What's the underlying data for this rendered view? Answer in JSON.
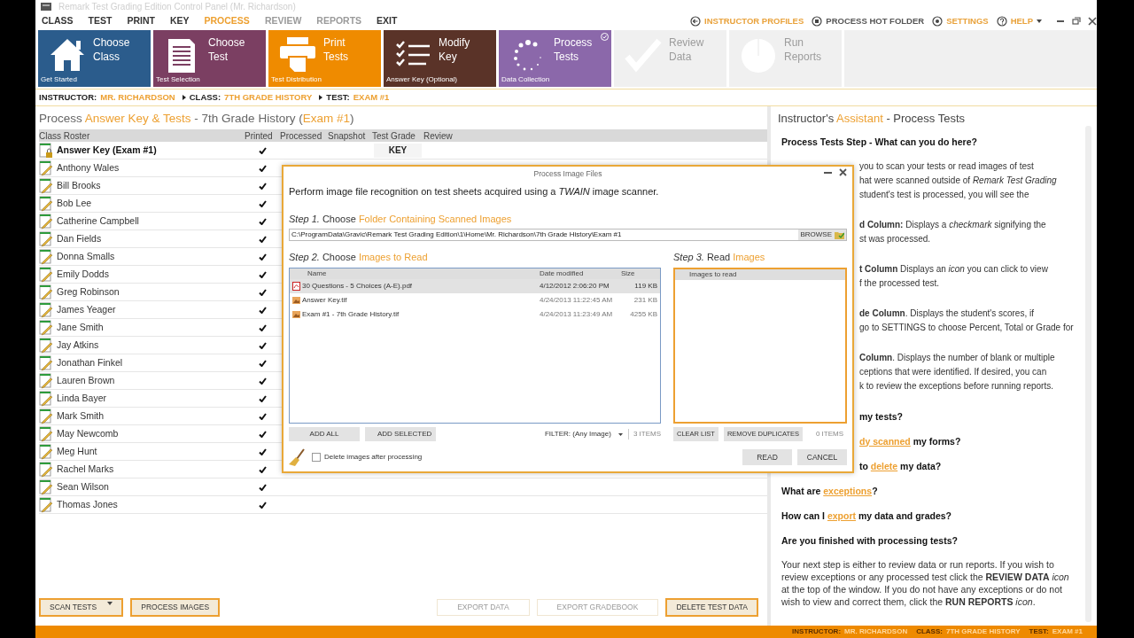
{
  "window": {
    "title": "Remark Test Grading Edition Control Panel (Mr. Richardson)"
  },
  "menu": [
    {
      "label": "CLASS",
      "selected": false,
      "disabled": false
    },
    {
      "label": "TEST",
      "selected": false,
      "disabled": false
    },
    {
      "label": "PRINT",
      "selected": false,
      "disabled": false
    },
    {
      "label": "KEY",
      "selected": false,
      "disabled": false
    },
    {
      "label": "PROCESS",
      "selected": true,
      "disabled": false
    },
    {
      "label": "REVIEW",
      "selected": false,
      "disabled": true
    },
    {
      "label": "REPORTS",
      "selected": false,
      "disabled": true
    },
    {
      "label": "EXIT",
      "selected": false,
      "disabled": false
    }
  ],
  "header_links": [
    {
      "label": "INSTRUCTOR PROFILES",
      "kind": "back",
      "highlighted": true,
      "has_menu": false
    },
    {
      "label": "PROCESS HOT FOLDER",
      "kind": "folder",
      "highlighted": false,
      "has_menu": false
    },
    {
      "label": "SETTINGS",
      "kind": "settings",
      "highlighted": true,
      "has_menu": false
    },
    {
      "label": "HELP",
      "kind": "help",
      "highlighted": true,
      "has_menu": true
    }
  ],
  "tiles": [
    {
      "title": "Choose Class",
      "subtitle": "Get Started",
      "kind": "house",
      "color": "#2b5c8c",
      "selected": false,
      "disabled": false
    },
    {
      "title": "Choose Test",
      "subtitle": "Test Selection",
      "kind": "document",
      "color": "#7b3f62",
      "selected": false,
      "disabled": false
    },
    {
      "title": "Print Tests",
      "subtitle": "Test Distribution",
      "kind": "printer",
      "color": "#ef8b00",
      "selected": false,
      "disabled": false
    },
    {
      "title": "Modify Key",
      "subtitle": "Answer Key (Optional)",
      "kind": "checklist",
      "color": "#5a3328",
      "selected": false,
      "disabled": false
    },
    {
      "title": "Process Tests",
      "subtitle": "Data Collection",
      "kind": "spinner",
      "color": "#8b68aa",
      "selected": true,
      "disabled": false
    },
    {
      "title": "Review Data",
      "kind": "check",
      "color": "#f0f0f0",
      "selected": false,
      "disabled": true
    },
    {
      "title": "Run Reports",
      "kind": "pie",
      "color": "#f0f0f0",
      "selected": false,
      "disabled": true
    }
  ],
  "breadcrumb": [
    {
      "label": "INSTRUCTOR:",
      "value": "MR. RICHARDSON"
    },
    {
      "label": "CLASS:",
      "value": "7TH GRADE HISTORY"
    },
    {
      "label": "TEST:",
      "value": "EXAM #1"
    }
  ],
  "roster": {
    "title": [
      {
        "text": "Process ",
        "accent": false
      },
      {
        "text": "Answer Key & Tests",
        "accent": true
      },
      {
        "text": " - 7th Grade History (",
        "accent": false
      },
      {
        "text": "Exam #1",
        "accent": true
      },
      {
        "text": ")",
        "accent": false
      }
    ],
    "columns": [
      "Class Roster",
      "Printed",
      "Processed",
      "Snapshot",
      "Test Grade",
      "Review"
    ],
    "rows": [
      {
        "name": "Answer Key (Exam #1)",
        "kind": "key",
        "printed": true,
        "test_grade": "KEY"
      },
      {
        "name": "Anthony Wales",
        "kind": "student",
        "printed": true
      },
      {
        "name": "Bill Brooks",
        "kind": "student",
        "printed": true
      },
      {
        "name": "Bob Lee",
        "kind": "student",
        "printed": true
      },
      {
        "name": "Catherine Campbell",
        "kind": "student",
        "printed": true
      },
      {
        "name": "Dan Fields",
        "kind": "student",
        "printed": true
      },
      {
        "name": "Donna Smalls",
        "kind": "student",
        "printed": true
      },
      {
        "name": "Emily Dodds",
        "kind": "student",
        "printed": true
      },
      {
        "name": "Greg Robinson",
        "kind": "student",
        "printed": true
      },
      {
        "name": "James Yeager",
        "kind": "student",
        "printed": true
      },
      {
        "name": "Jane Smith",
        "kind": "student",
        "printed": true
      },
      {
        "name": "Jay Atkins",
        "kind": "student",
        "printed": true
      },
      {
        "name": "Jonathan Finkel",
        "kind": "student",
        "printed": true
      },
      {
        "name": "Lauren Brown",
        "kind": "student",
        "printed": true
      },
      {
        "name": "Linda Bayer",
        "kind": "student",
        "printed": true
      },
      {
        "name": "Mark Smith",
        "kind": "student",
        "printed": true
      },
      {
        "name": "May Newcomb",
        "kind": "student",
        "printed": true
      },
      {
        "name": "Meg Hunt",
        "kind": "student",
        "printed": true
      },
      {
        "name": "Rachel Marks",
        "kind": "student",
        "printed": true
      },
      {
        "name": "Sean Wilson",
        "kind": "student",
        "printed": true
      },
      {
        "name": "Thomas Jones",
        "kind": "student",
        "printed": true
      }
    ],
    "buttons": [
      {
        "label": "SCAN TESTS",
        "has_menu": true,
        "disabled": false
      },
      {
        "label": "PROCESS IMAGES",
        "has_menu": false,
        "disabled": false
      }
    ],
    "data_buttons": [
      {
        "label": "EXPORT DATA",
        "disabled": true
      },
      {
        "label": "EXPORT GRADEBOOK",
        "disabled": true
      },
      {
        "label": "DELETE TEST DATA",
        "disabled": false
      }
    ]
  },
  "dialog": {
    "title": "Process Image Files",
    "description": "Perform image file recognition  on test sheets acquired using a *TWAIN* image scanner.",
    "steps": [
      {
        "number": "Step 1.",
        "verb": "Choose",
        "target": "Folder Containing Scanned Images"
      },
      {
        "number": "Step 2.",
        "verb": "Choose",
        "target": "Images to Read"
      },
      {
        "number": "Step 3.",
        "verb": "Read",
        "target": "Images"
      }
    ],
    "folder": "C:\\ProgramData\\Gravic\\Remark Test Grading Edition\\1\\Home\\Mr. Richardson\\7th Grade History\\Exam #1",
    "browse": "BROWSE",
    "file_columns": [
      "Name",
      "Date modified",
      "Size"
    ],
    "files": [
      {
        "name": "30 Questions - 5 Choices (A-E).pdf",
        "modified": "4/12/2012 2:06:20 PM",
        "size": "119 KB",
        "kind": "pdf",
        "selected": true
      },
      {
        "name": "Answer Key.tif",
        "modified": "4/24/2013 11:22:45 AM",
        "size": "231 KB",
        "kind": "image",
        "selected": false
      },
      {
        "name": "Exam #1 - 7th Grade History.tif",
        "modified": "4/24/2013 11:23:49 AM",
        "size": "4255 KB",
        "kind": "image",
        "selected": false
      }
    ],
    "read_column": "Images to read",
    "left_buttons": [
      "ADD ALL",
      "ADD SELECTED"
    ],
    "filter": "FILTER: (Any Image)",
    "file_count": "3 ITEMS",
    "right_buttons": [
      "CLEAR LIST",
      "REMOVE DUPLICATES"
    ],
    "read_count": "0 ITEMS",
    "delete_option": {
      "label": "Delete images after processing",
      "checked": false
    },
    "actions": [
      "READ",
      "CANCEL"
    ]
  },
  "assistant": {
    "title": [
      {
        "text": "Instructor's ",
        "accent": false
      },
      {
        "text": "Assistant",
        "accent": true
      },
      {
        "text": " - Process Tests",
        "accent": false
      }
    ],
    "items": [
      {
        "kind": "heading",
        "partial": false,
        "parts": [
          {
            "text": "Process Tests Step - What can you do here?",
            "link": false
          }
        ]
      },
      {
        "kind": "paragraph",
        "partial": true,
        "text": "you to scan your tests or read images of test\nhat were scanned outside of *Remark Test Grading*\nstudent's test is processed, you will see the"
      },
      {
        "kind": "paragraph",
        "partial": true,
        "text": "**d Column:** Displays a *checkmark* signifying the\nst was processed."
      },
      {
        "kind": "paragraph",
        "partial": true,
        "text": "**t Column** Displays an *icon* you can click to view\nf the processed test."
      },
      {
        "kind": "paragraph",
        "partial": true,
        "text": "**de Column**. Displays the student's scores, if\ngo to SETTINGS to choose Percent, Total or Grade for"
      },
      {
        "kind": "paragraph",
        "partial": true,
        "text": "**Column**. Displays the number of blank or multiple\nceptions that were identified. If desired, you can\nk to review the exceptions before running reports."
      },
      {
        "kind": "heading",
        "partial": true,
        "parts": [
          {
            "text": "my tests?",
            "link": false
          }
        ]
      },
      {
        "kind": "heading",
        "partial": true,
        "parts": [
          {
            "text": "dy scanned",
            "link": true
          },
          {
            "text": " my forms?",
            "link": false
          }
        ]
      },
      {
        "kind": "heading",
        "partial": true,
        "parts": [
          {
            "text": "to ",
            "link": false
          },
          {
            "text": "delete",
            "link": true
          },
          {
            "text": " my data?",
            "link": false
          }
        ]
      },
      {
        "kind": "heading",
        "partial": false,
        "parts": [
          {
            "text": "What are ",
            "link": false
          },
          {
            "text": "exceptions",
            "link": true
          },
          {
            "text": "?",
            "link": false
          }
        ]
      },
      {
        "kind": "heading",
        "partial": false,
        "parts": [
          {
            "text": "How can I ",
            "link": false
          },
          {
            "text": "export",
            "link": true
          },
          {
            "text": " my data and grades?",
            "link": false
          }
        ]
      },
      {
        "kind": "heading",
        "partial": false,
        "parts": [
          {
            "text": "Are you finished with processing tests?",
            "link": false
          }
        ]
      },
      {
        "kind": "paragraph",
        "partial": false,
        "text": "Your next step is either to review data or run reports. If you wish to review exceptions or any processed test click the **REVIEW DATA** *icon* at the top of the window. If you do not have any exceptions or do not wish to view and correct them, click the **RUN REPORTS** *icon*."
      }
    ]
  },
  "status_bar": [
    {
      "label": "INSTRUCTOR:",
      "value": "MR. RICHARDSON"
    },
    {
      "label": "CLASS:",
      "value": "7TH GRADE HISTORY"
    },
    {
      "label": "TEST:",
      "value": "EXAM #1"
    }
  ]
}
